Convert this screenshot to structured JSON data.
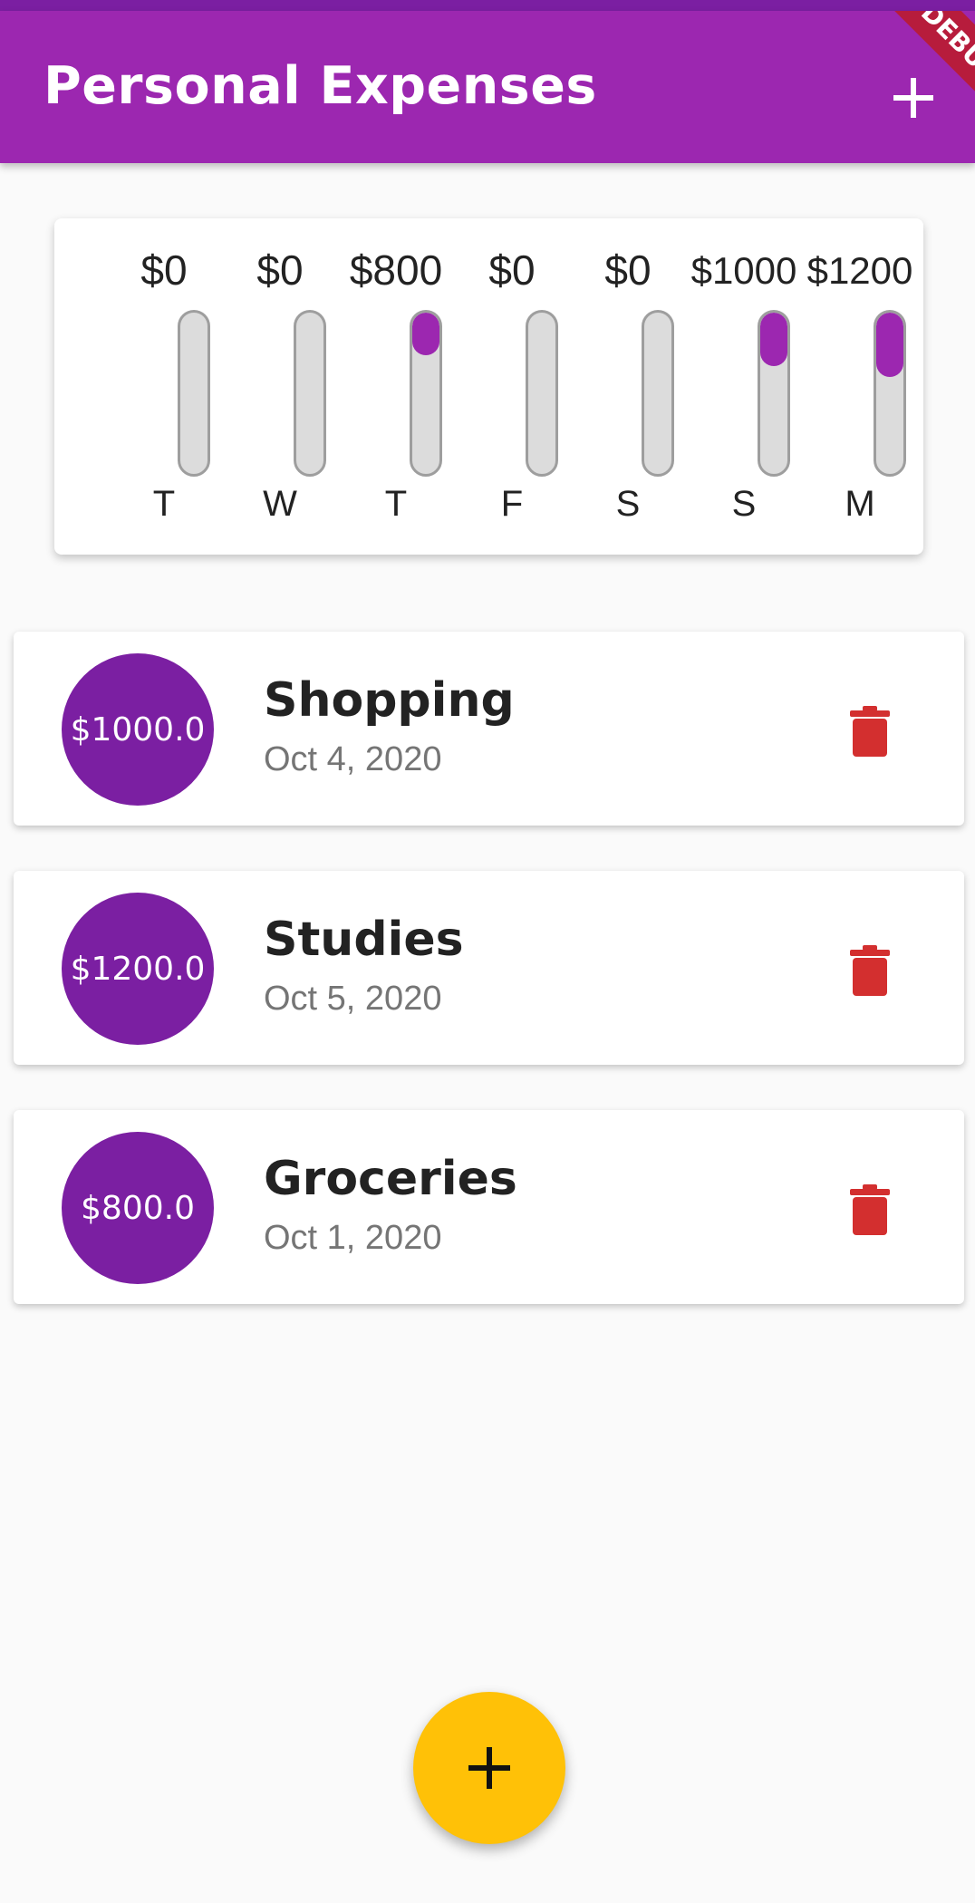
{
  "app_bar": {
    "title": "Personal Expenses",
    "add_icon": "plus-icon",
    "debug_banner": "DEBUG",
    "background": "#9c27b0"
  },
  "chart": {
    "bars": [
      {
        "day": "T",
        "amount_label": "$0",
        "amount": 0,
        "fill_fraction": 0.0
      },
      {
        "day": "W",
        "amount_label": "$0",
        "amount": 0,
        "fill_fraction": 0.0
      },
      {
        "day": "T",
        "amount_label": "$800",
        "amount": 800,
        "fill_fraction": 0.265
      },
      {
        "day": "F",
        "amount_label": "$0",
        "amount": 0,
        "fill_fraction": 0.0
      },
      {
        "day": "S",
        "amount_label": "$0",
        "amount": 0,
        "fill_fraction": 0.0
      },
      {
        "day": "S",
        "amount_label": "$1000",
        "amount": 1000,
        "fill_fraction": 0.333
      },
      {
        "day": "M",
        "amount_label": "$1200",
        "amount": 1200,
        "fill_fraction": 0.4
      }
    ],
    "fill_color": "#9c27b0",
    "track_color": "#dcdcdc"
  },
  "transactions": [
    {
      "amount": "$1000.0",
      "title": "Shopping",
      "date": "Oct 4, 2020",
      "delete_icon": "trash-icon"
    },
    {
      "amount": "$1200.0",
      "title": "Studies",
      "date": "Oct 5, 2020",
      "delete_icon": "trash-icon"
    },
    {
      "amount": "$800.0",
      "title": "Groceries",
      "date": "Oct 1, 2020",
      "delete_icon": "trash-icon"
    }
  ],
  "fab": {
    "icon": "plus-icon",
    "color": "#ffc107"
  },
  "colors": {
    "avatar": "#7b1fa2",
    "delete": "#d32f2f"
  }
}
